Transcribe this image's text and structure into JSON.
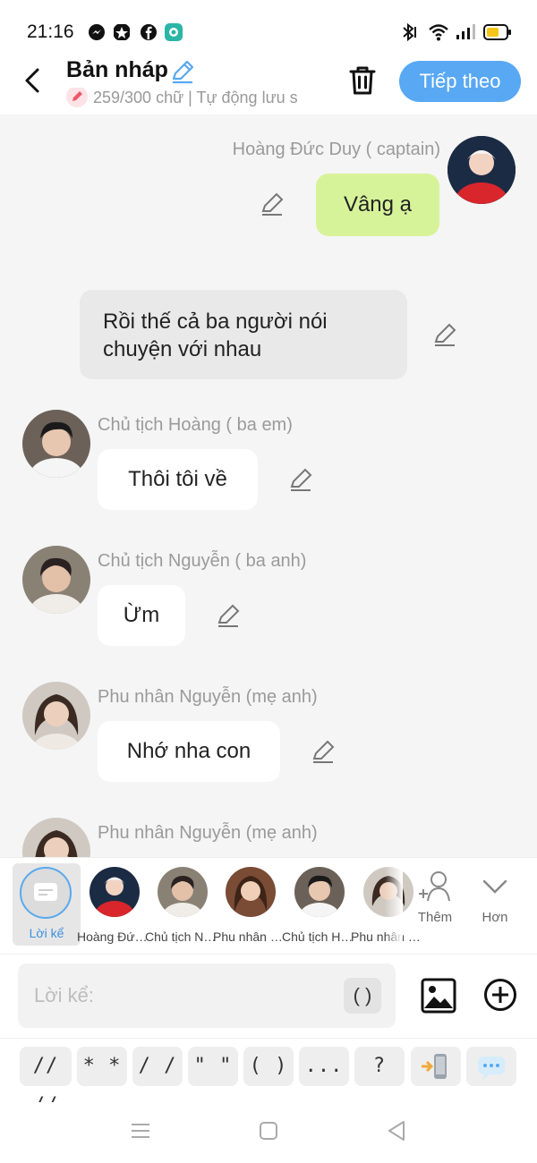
{
  "status_bar": {
    "time": "21:16",
    "icons": [
      "messenger-icon",
      "app-icon",
      "facebook-icon",
      "app2-icon",
      "bluetooth-icon",
      "wifi-icon",
      "signal-icon",
      "battery-icon"
    ]
  },
  "header": {
    "title": "Bản nháp",
    "subtitle": "259/300 chữ | Tự động lưu s",
    "next_label": "Tiếp theo"
  },
  "messages": [
    {
      "sender": "Hoàng Đức Duy ( captain)",
      "text": "Vâng ạ",
      "side": "right"
    },
    {
      "sender": "",
      "text_line1": "Rồi thế cả ba người nói",
      "text_line2": "chuyện với nhau",
      "side": "narration"
    },
    {
      "sender": "Chủ tịch Hoàng ( ba em)",
      "text": "Thôi tôi về",
      "side": "left"
    },
    {
      "sender": "Chủ tịch Nguyễn ( ba anh)",
      "text": "Ừm",
      "side": "left"
    },
    {
      "sender": "Phu nhân Nguyễn (mẹ anh)",
      "text": "Nhớ nha con",
      "side": "left"
    },
    {
      "sender": "Phu nhân Nguyễn (mẹ anh)",
      "text": "",
      "side": "left"
    }
  ],
  "characters": [
    {
      "label": "Lời kể"
    },
    {
      "label": "Hoàng Đức Duy ( captain)"
    },
    {
      "label": "Chủ tịch Nguyễn ( ba anh)"
    },
    {
      "label": "Phu nhân Nguyễn (mẹ anh)"
    },
    {
      "label": "Chủ tịch Hoàng ( ba em)"
    },
    {
      "label": "Phu nhân Nguyễn"
    }
  ],
  "tools": {
    "add_label": "Thêm",
    "more_label": "Hơn"
  },
  "input": {
    "placeholder": "Lời kể:",
    "paren": "( )"
  },
  "symbols": [
    "// //",
    "* *",
    "/ /",
    "\" \"",
    "( )",
    "...",
    "?"
  ],
  "colors": {
    "accent": "#58a8f3",
    "bubble_self": "#d7f39a",
    "narration_bg": "#e9e9e9"
  }
}
